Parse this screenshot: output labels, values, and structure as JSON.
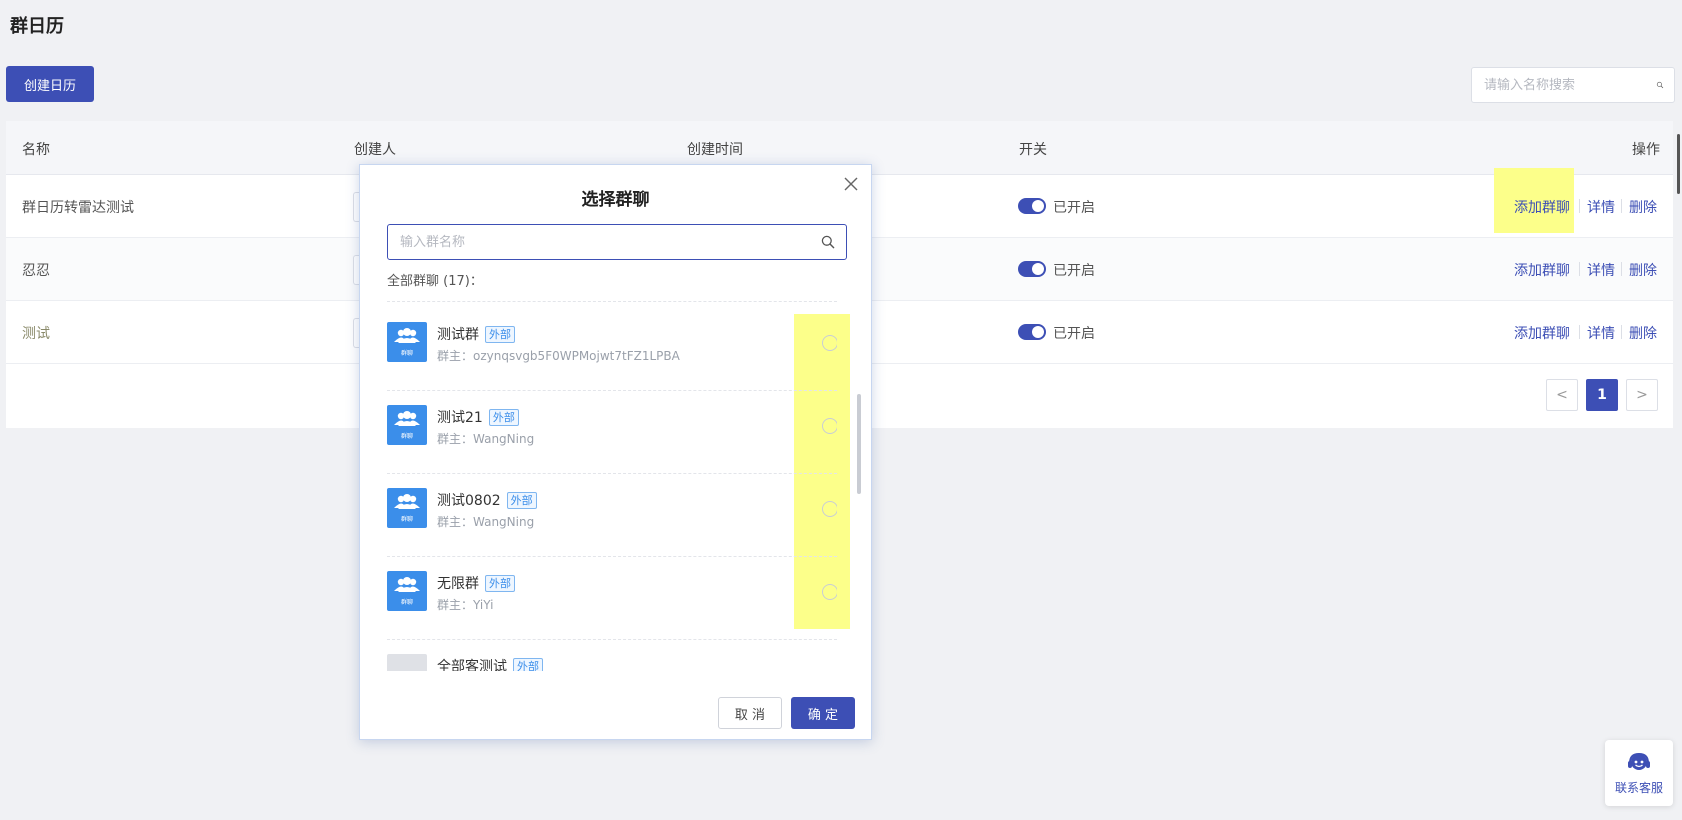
{
  "page": {
    "title": "群日历",
    "create_button": "创建日历",
    "search_placeholder": "请输入名称搜索"
  },
  "table": {
    "headers": {
      "name": "名称",
      "creator": "创建人",
      "created_time": "创建时间",
      "switch": "开关",
      "actions": "操作"
    },
    "rows": [
      {
        "name": "群日历转雷达测试",
        "switch_label": "已开启",
        "switch_on": true
      },
      {
        "name": "忍忍",
        "switch_label": "已开启",
        "switch_on": true
      },
      {
        "name": "测试",
        "switch_label": "已开启",
        "switch_on": true
      }
    ],
    "actions": {
      "add_group": "添加群聊",
      "detail": "详情",
      "delete": "删除"
    }
  },
  "pagination": {
    "prev": "<",
    "current": "1",
    "next": ">"
  },
  "modal": {
    "title": "选择群聊",
    "search_placeholder": "输入群名称",
    "count_label": "全部群聊 (17)：",
    "avatar_label": "群聊",
    "groups": [
      {
        "name": "测试群",
        "tag": "外部",
        "owner": "群主：ozynqsvgb5F0WPMojwt7tFZ1LPBA"
      },
      {
        "name": "测试21",
        "tag": "外部",
        "owner": "群主：WangNing"
      },
      {
        "name": "测试0802",
        "tag": "外部",
        "owner": "群主：WangNing"
      },
      {
        "name": "无限群",
        "tag": "外部",
        "owner": "群主：YiYi"
      },
      {
        "name": "全部客测试",
        "tag": "外部",
        "owner": ""
      }
    ],
    "cancel": "取 消",
    "confirm": "确 定"
  },
  "support": {
    "label": "联系客服"
  },
  "colors": {
    "primary": "#3d4fb5",
    "highlight": "#fcff8a",
    "avatar": "#3b8eea",
    "tag_border": "#7fb6f0"
  },
  "icons": {
    "search": "search-icon",
    "close": "close-icon",
    "group_avatar": "group-avatar-icon",
    "customer_service": "headset-icon"
  }
}
